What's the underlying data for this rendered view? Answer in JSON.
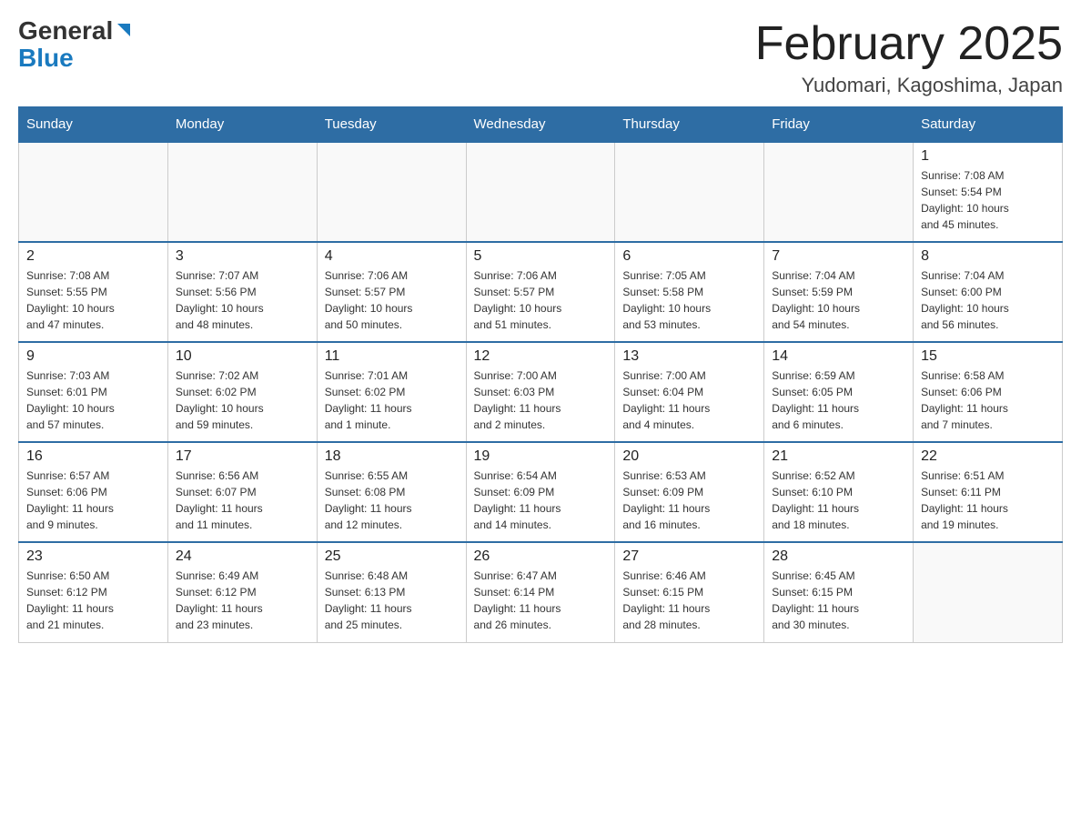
{
  "header": {
    "logo_general": "General",
    "logo_blue": "Blue",
    "month_title": "February 2025",
    "location": "Yudomari, Kagoshima, Japan"
  },
  "days_of_week": [
    "Sunday",
    "Monday",
    "Tuesday",
    "Wednesday",
    "Thursday",
    "Friday",
    "Saturday"
  ],
  "weeks": [
    [
      {
        "day": "",
        "info": ""
      },
      {
        "day": "",
        "info": ""
      },
      {
        "day": "",
        "info": ""
      },
      {
        "day": "",
        "info": ""
      },
      {
        "day": "",
        "info": ""
      },
      {
        "day": "",
        "info": ""
      },
      {
        "day": "1",
        "info": "Sunrise: 7:08 AM\nSunset: 5:54 PM\nDaylight: 10 hours\nand 45 minutes."
      }
    ],
    [
      {
        "day": "2",
        "info": "Sunrise: 7:08 AM\nSunset: 5:55 PM\nDaylight: 10 hours\nand 47 minutes."
      },
      {
        "day": "3",
        "info": "Sunrise: 7:07 AM\nSunset: 5:56 PM\nDaylight: 10 hours\nand 48 minutes."
      },
      {
        "day": "4",
        "info": "Sunrise: 7:06 AM\nSunset: 5:57 PM\nDaylight: 10 hours\nand 50 minutes."
      },
      {
        "day": "5",
        "info": "Sunrise: 7:06 AM\nSunset: 5:57 PM\nDaylight: 10 hours\nand 51 minutes."
      },
      {
        "day": "6",
        "info": "Sunrise: 7:05 AM\nSunset: 5:58 PM\nDaylight: 10 hours\nand 53 minutes."
      },
      {
        "day": "7",
        "info": "Sunrise: 7:04 AM\nSunset: 5:59 PM\nDaylight: 10 hours\nand 54 minutes."
      },
      {
        "day": "8",
        "info": "Sunrise: 7:04 AM\nSunset: 6:00 PM\nDaylight: 10 hours\nand 56 minutes."
      }
    ],
    [
      {
        "day": "9",
        "info": "Sunrise: 7:03 AM\nSunset: 6:01 PM\nDaylight: 10 hours\nand 57 minutes."
      },
      {
        "day": "10",
        "info": "Sunrise: 7:02 AM\nSunset: 6:02 PM\nDaylight: 10 hours\nand 59 minutes."
      },
      {
        "day": "11",
        "info": "Sunrise: 7:01 AM\nSunset: 6:02 PM\nDaylight: 11 hours\nand 1 minute."
      },
      {
        "day": "12",
        "info": "Sunrise: 7:00 AM\nSunset: 6:03 PM\nDaylight: 11 hours\nand 2 minutes."
      },
      {
        "day": "13",
        "info": "Sunrise: 7:00 AM\nSunset: 6:04 PM\nDaylight: 11 hours\nand 4 minutes."
      },
      {
        "day": "14",
        "info": "Sunrise: 6:59 AM\nSunset: 6:05 PM\nDaylight: 11 hours\nand 6 minutes."
      },
      {
        "day": "15",
        "info": "Sunrise: 6:58 AM\nSunset: 6:06 PM\nDaylight: 11 hours\nand 7 minutes."
      }
    ],
    [
      {
        "day": "16",
        "info": "Sunrise: 6:57 AM\nSunset: 6:06 PM\nDaylight: 11 hours\nand 9 minutes."
      },
      {
        "day": "17",
        "info": "Sunrise: 6:56 AM\nSunset: 6:07 PM\nDaylight: 11 hours\nand 11 minutes."
      },
      {
        "day": "18",
        "info": "Sunrise: 6:55 AM\nSunset: 6:08 PM\nDaylight: 11 hours\nand 12 minutes."
      },
      {
        "day": "19",
        "info": "Sunrise: 6:54 AM\nSunset: 6:09 PM\nDaylight: 11 hours\nand 14 minutes."
      },
      {
        "day": "20",
        "info": "Sunrise: 6:53 AM\nSunset: 6:09 PM\nDaylight: 11 hours\nand 16 minutes."
      },
      {
        "day": "21",
        "info": "Sunrise: 6:52 AM\nSunset: 6:10 PM\nDaylight: 11 hours\nand 18 minutes."
      },
      {
        "day": "22",
        "info": "Sunrise: 6:51 AM\nSunset: 6:11 PM\nDaylight: 11 hours\nand 19 minutes."
      }
    ],
    [
      {
        "day": "23",
        "info": "Sunrise: 6:50 AM\nSunset: 6:12 PM\nDaylight: 11 hours\nand 21 minutes."
      },
      {
        "day": "24",
        "info": "Sunrise: 6:49 AM\nSunset: 6:12 PM\nDaylight: 11 hours\nand 23 minutes."
      },
      {
        "day": "25",
        "info": "Sunrise: 6:48 AM\nSunset: 6:13 PM\nDaylight: 11 hours\nand 25 minutes."
      },
      {
        "day": "26",
        "info": "Sunrise: 6:47 AM\nSunset: 6:14 PM\nDaylight: 11 hours\nand 26 minutes."
      },
      {
        "day": "27",
        "info": "Sunrise: 6:46 AM\nSunset: 6:15 PM\nDaylight: 11 hours\nand 28 minutes."
      },
      {
        "day": "28",
        "info": "Sunrise: 6:45 AM\nSunset: 6:15 PM\nDaylight: 11 hours\nand 30 minutes."
      },
      {
        "day": "",
        "info": ""
      }
    ]
  ]
}
